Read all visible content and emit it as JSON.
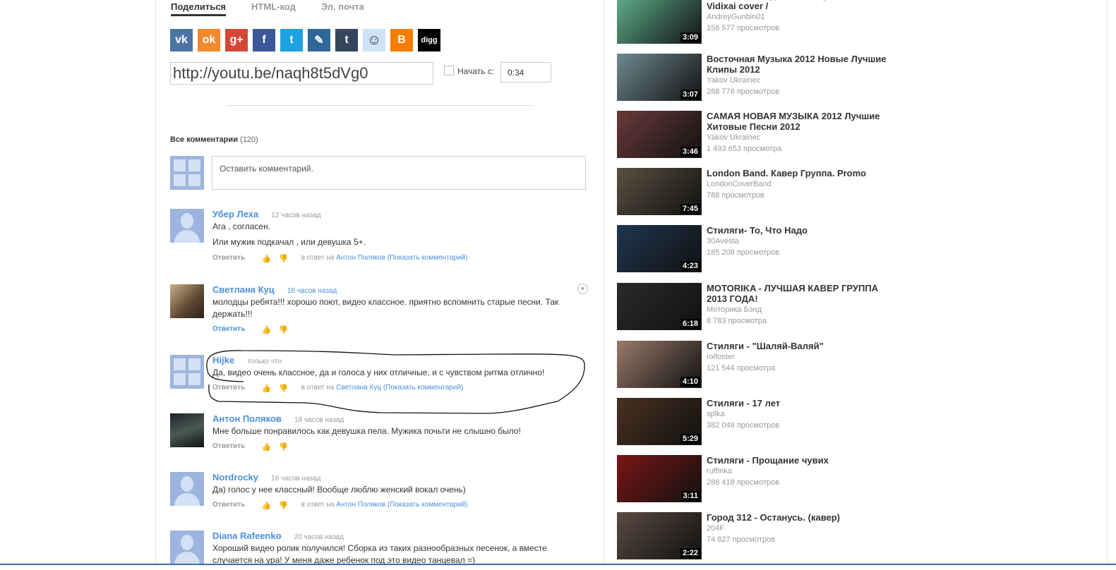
{
  "share": {
    "tabs": [
      {
        "label": "Поделиться",
        "active": true
      },
      {
        "label": "HTML-код",
        "active": false
      },
      {
        "label": "Эл. почта",
        "active": false
      }
    ],
    "social": [
      {
        "name": "vk",
        "glyph": "vk",
        "color": "#4c75a3"
      },
      {
        "name": "odnoklassniki",
        "glyph": "ok",
        "color": "#f4882b"
      },
      {
        "name": "google-plus",
        "glyph": "g+",
        "color": "#d34836"
      },
      {
        "name": "facebook",
        "glyph": "f",
        "color": "#3b5998"
      },
      {
        "name": "twitter",
        "glyph": "t",
        "color": "#1da1e2"
      },
      {
        "name": "livejournal",
        "glyph": "✎",
        "color": "#2f6798"
      },
      {
        "name": "tumblr",
        "glyph": "t",
        "color": "#35465c"
      },
      {
        "name": "reddit",
        "glyph": "☺",
        "color": "#cee3f8"
      },
      {
        "name": "blogger",
        "glyph": "B",
        "color": "#f57d00"
      },
      {
        "name": "digg",
        "glyph": "digg",
        "color": "#000000"
      }
    ],
    "url": "http://youtu.be/naqh8t5dVg0",
    "start_label": "Начать с:",
    "start_time": "0:34"
  },
  "comments_header": {
    "label": "Все комментарии",
    "count": "(120)"
  },
  "comment_box": {
    "placeholder": "Оставить комментарий."
  },
  "reply_label": "Ответить",
  "in_reply_prefix": "в ответ на",
  "show_comment": "(Показать комментарий)",
  "comments": [
    {
      "author": "Убер Леха",
      "time": "12 часов назад",
      "lines": [
        "Ага , согласен.",
        "Или мужик подкачал , или девушка 5+."
      ],
      "reply_to": "Антон Поляков",
      "avatar": "default"
    },
    {
      "author": "Светлана Куц",
      "time": "16 часов назад",
      "lines": [
        "молодцы ребята!!! хорошо поют, видео классное. приятно вспомнить старые песни. Так держать!!!"
      ],
      "reply_to": null,
      "avatar": "photo1"
    },
    {
      "author": "Hijke",
      "time": "только что",
      "lines": [
        "Да, видео очень классное, да и голоса у них отличные, и с чувством ритма отлично!"
      ],
      "reply_to": "Светлана Куц",
      "avatar": "g"
    },
    {
      "author": "Антон Поляков",
      "time": "18 часов назад",
      "lines": [
        "Мне больше понравилось как девушка пела. Мужика почьти не слышно было!"
      ],
      "reply_to": null,
      "avatar": "photo2"
    },
    {
      "author": "Nordrocky",
      "time": "16 часов назад",
      "lines": [
        "Да) голос у нее классный! Вообще люблю женский вокал очень)"
      ],
      "reply_to": "Антон Поляков",
      "avatar": "default"
    },
    {
      "author": "Diana Rafeenko",
      "time": "20 часов назад",
      "lines": [
        "Хороший видео ролик получился! Сборка из таких разнообразных песенок, а вместе случается на ура! У меня даже ребенок под это видео танцевал =)"
      ],
      "reply_to": null,
      "avatar": "default"
    }
  ],
  "related": [
    {
      "title": "Noize MC - Выдыхай кавер / Noize MC - Vidixai cover /",
      "channel": "AndreyGunbin01",
      "views": "158 577 просмотров",
      "duration": "3:09",
      "thumb": "#5fae8e"
    },
    {
      "title": "Восточная Музыка 2012 Новые Лучшие Клипы 2012",
      "channel": "Yakov Ukrainec",
      "views": "288 776 просмотров",
      "duration": "3:07",
      "thumb": "#6f8a92"
    },
    {
      "title": "САМАЯ НОВАЯ МУЗЫКА 2012 Лучшие Хитовые Песни 2012",
      "channel": "Yakov Ukrainec",
      "views": "1 493 653 просмотра",
      "duration": "3:46",
      "thumb": "#6a3a3a"
    },
    {
      "title": "London Band. Кавер Группа. Promo",
      "channel": "LondonCoverBand",
      "views": "788 просмотров",
      "duration": "7:45",
      "thumb": "#5a5040"
    },
    {
      "title": "Стиляги- То, Что Надо",
      "channel": "30Avesta",
      "views": "185 208 просмотров",
      "duration": "4:23",
      "thumb": "#1e3650"
    },
    {
      "title": "MOTORIKA - ЛУЧШАЯ КАВЕР ГРУППА 2013 ГОДА!",
      "channel": "Моторика Бэнд",
      "views": "8 783 просмотра",
      "duration": "6:18",
      "thumb": "#2a2a2a"
    },
    {
      "title": "Стиляги - \"Шаляй-Валяй\"",
      "channel": "rolfoster",
      "views": "121 544 просмотра",
      "duration": "4:10",
      "thumb": "#9a7a6a"
    },
    {
      "title": "Стиляги - 17 лет",
      "channel": "splka",
      "views": "382 049 просмотров",
      "duration": "5:29",
      "thumb": "#4a3020"
    },
    {
      "title": "Стиляги - Прощание чувих",
      "channel": "ruffinka",
      "views": "288 418 просмотров",
      "duration": "3:11",
      "thumb": "#7a1515"
    },
    {
      "title": "Город 312 - Останусь. (кавер)",
      "channel": "204F",
      "views": "74 827 просмотров",
      "duration": "2:22",
      "thumb": "#5a4a40"
    }
  ]
}
